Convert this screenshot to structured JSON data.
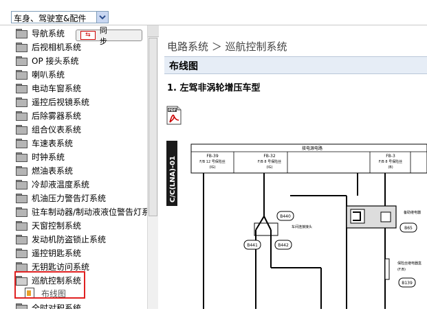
{
  "category_select": {
    "value": "车身、驾驶室&配件"
  },
  "sync_button": {
    "label": "同 步",
    "icon_text": "⇆"
  },
  "tree": {
    "items": [
      {
        "label": "导航系统"
      },
      {
        "label": "后视相机系统"
      },
      {
        "label": "OP 接头系统"
      },
      {
        "label": "喇叭系统"
      },
      {
        "label": "电动车窗系统"
      },
      {
        "label": "遥控后视镜系统"
      },
      {
        "label": "后除雾器系统"
      },
      {
        "label": "组合仪表系统"
      },
      {
        "label": "车速表系统"
      },
      {
        "label": "时钟系统"
      },
      {
        "label": "燃油表系统"
      },
      {
        "label": "冷却液温度系统"
      },
      {
        "label": "机油压力警告灯系统"
      },
      {
        "label": "驻车制动器/制动液液位警告灯系"
      },
      {
        "label": "天窗控制系统"
      },
      {
        "label": "发动机防盗锁止系统"
      },
      {
        "label": "遥控钥匙系统"
      },
      {
        "label": "无钥匙访问系统"
      },
      {
        "label": "巡航控制系统"
      },
      {
        "label": "全时对积系统"
      }
    ],
    "selected_child": {
      "label": "布线图"
    }
  },
  "content": {
    "breadcrumb": "电路系统 ＞ 巡航控制系统",
    "section_title": "布线图",
    "subheading": "1.  左驾非涡轮增压车型",
    "pdf_label": "PDF"
  },
  "diagram": {
    "side_label": "C/C(LNA)-01",
    "top_label": "接电源电路",
    "fuses": [
      {
        "code": "FB-39",
        "name": "F/B 12 号保险丝",
        "type": "(IG)"
      },
      {
        "code": "FB-32",
        "name": "F/B 8 号保险丝",
        "type": "(IG)"
      },
      {
        "code": "FB-3",
        "name": "F/B 8 号保险丝",
        "type": "(B)"
      }
    ],
    "connectors": [
      "B440",
      "B441",
      "B442",
      "B65",
      "B139"
    ],
    "notes": [
      "车间连接接头",
      "备助继电器",
      "(F/B)",
      "保险丝继电器盒"
    ]
  },
  "colors": {
    "highlight": "#e02020",
    "section_bg": "#e6edf6",
    "pdf_red": "#cc0000"
  }
}
